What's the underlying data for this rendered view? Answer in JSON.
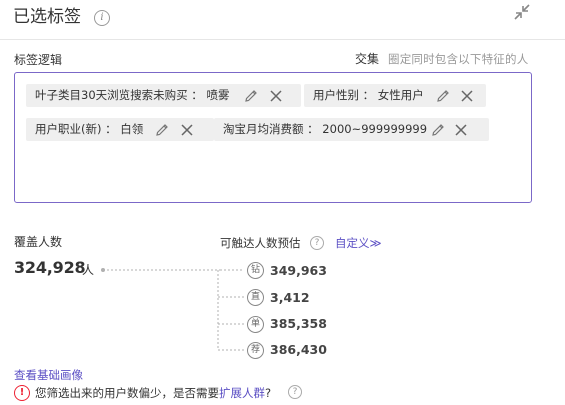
{
  "header": {
    "title": "已选标签",
    "info_glyph": "i",
    "collapse_icon": "collapse-icon"
  },
  "logic": {
    "label": "标签逻辑",
    "mode": "交集",
    "mode_desc": "圈定同时包含以下特征的人"
  },
  "tags": [
    {
      "text": "叶子类目30天浏览搜索未购买 ： 喷雾"
    },
    {
      "text": "用户性别 ： 女性用户"
    },
    {
      "text": "用户职业(新) ： 白领"
    },
    {
      "text": "淘宝月均消费额 ： 2000~999999999"
    }
  ],
  "coverage": {
    "label": "覆盖人数",
    "value": "324,928",
    "unit": "人"
  },
  "reach": {
    "label": "可触达人数预估",
    "help_glyph": "?",
    "custom_label": "自定义≫",
    "channels": [
      {
        "icon_char": "钻",
        "icon": "diamond-channel-icon",
        "value": "349,963"
      },
      {
        "icon_char": "直",
        "icon": "direct-channel-icon",
        "value": "3,412"
      },
      {
        "icon_char": "单",
        "icon": "single-channel-icon",
        "value": "385,358"
      },
      {
        "icon_char": "荐",
        "icon": "recommend-channel-icon",
        "value": "386,430"
      }
    ]
  },
  "footer": {
    "base_link": "查看基础画像",
    "warn_glyph": "!",
    "warning_prefix": "您筛选出来的用户数偏少，是否需要",
    "warning_link": "扩展人群",
    "warning_suffix": "?",
    "help_glyph": "?"
  },
  "colors": {
    "accent": "#5b4fc4",
    "border_accent": "#7b68c8",
    "tag_bg": "#efefef",
    "warning": "#e22233"
  }
}
